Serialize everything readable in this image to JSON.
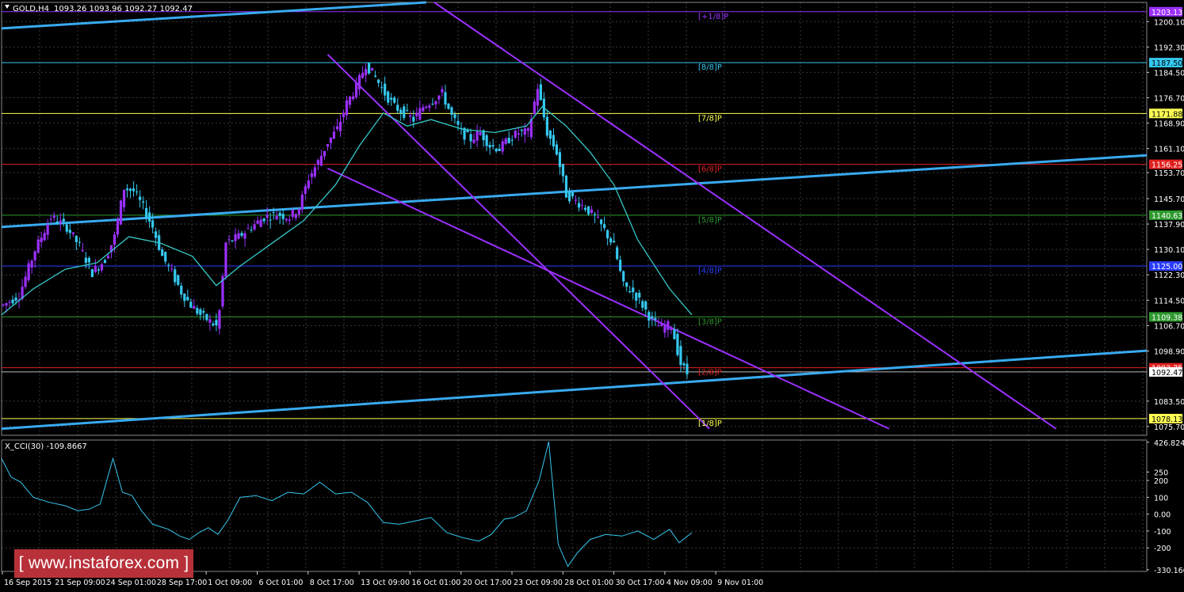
{
  "chart_header": {
    "symbol_label": "GOLD,H4",
    "ohlc": "1093.26 1093.96 1092.27 1092.47",
    "indicator_label": "X_CCI(30) -109.8667"
  },
  "watermark": {
    "text": "[ www.instaforex.com ]"
  },
  "colors": {
    "background": "#000000",
    "grid": "#3a3a3a",
    "bull": "#9b30ff",
    "bear": "#35c8f0",
    "ma": "#35c8c8",
    "channel_blue": "#39aaf0",
    "channel_purple": "#9b30ff",
    "cci": "#35c8f0"
  },
  "chart_data": {
    "type": "candlestick",
    "price_axis": {
      "ylim": [
        1073.0,
        1206.0
      ],
      "ticks": [
        "1200.10",
        "1192.30",
        "1184.50",
        "1176.70",
        "1168.90",
        "1161.10",
        "1153.70",
        "1145.70",
        "1137.90",
        "1130.10",
        "1122.30",
        "1114.50",
        "1106.70",
        "1098.90",
        "1083.50",
        "1075.70"
      ]
    },
    "time_axis": {
      "labels": [
        "16 Sep 2015",
        "21 Sep 09:00",
        "24 Sep 01:00",
        "28 Sep 17:00",
        "1 Oct 09:00",
        "6 Oct 01:00",
        "8 Oct 17:00",
        "13 Oct 09:00",
        "16 Oct 01:00",
        "20 Oct 17:00",
        "23 Oct 09:00",
        "28 Oct 01:00",
        "30 Oct 17:00",
        "4 Nov 09:00",
        "9 Nov 01:00"
      ]
    },
    "murrey_levels": [
      {
        "label": "[+1/8]P",
        "value": 1203.13,
        "price_text": "1203.13",
        "color": "#9b30ff"
      },
      {
        "label": "[8/8]P",
        "value": 1187.5,
        "price_text": "1187.50",
        "color": "#35c8f0"
      },
      {
        "label": "[7/8]P",
        "value": 1171.88,
        "price_text": "1171.88",
        "color": "#ffff55"
      },
      {
        "label": "[6/8]P",
        "value": 1156.25,
        "price_text": "1156.25",
        "color": "#e02020"
      },
      {
        "label": "[5/8]P",
        "value": 1140.63,
        "price_text": "1140.63",
        "color": "#2e9a2e"
      },
      {
        "label": "[4/8]P",
        "value": 1125.0,
        "price_text": "1125.00",
        "color": "#2a3cff"
      },
      {
        "label": "[3/8]P",
        "value": 1109.38,
        "price_text": "1109.38",
        "color": "#2e9a2e"
      },
      {
        "label": "[2/8]P",
        "value": 1093.75,
        "price_text": "1093.75",
        "color": "#e02020"
      },
      {
        "label": "[1/8]P",
        "value": 1078.13,
        "price_text": "1078.13",
        "color": "#ffff55"
      }
    ],
    "current_price": {
      "value": 1092.47,
      "price_text": "1092.47"
    },
    "close_path": [
      [
        0,
        1113
      ],
      [
        10,
        1116
      ],
      [
        20,
        1130
      ],
      [
        30,
        1140
      ],
      [
        40,
        1137
      ],
      [
        48,
        1131
      ],
      [
        56,
        1123
      ],
      [
        64,
        1127
      ],
      [
        70,
        1134
      ],
      [
        76,
        1149
      ],
      [
        82,
        1148
      ],
      [
        88,
        1143
      ],
      [
        94,
        1137
      ],
      [
        100,
        1128
      ],
      [
        106,
        1123
      ],
      [
        112,
        1117
      ],
      [
        118,
        1113
      ],
      [
        124,
        1110
      ],
      [
        130,
        1108
      ],
      [
        135,
        1106
      ],
      [
        140,
        1132
      ],
      [
        148,
        1134
      ],
      [
        156,
        1137
      ],
      [
        164,
        1140
      ],
      [
        172,
        1141
      ],
      [
        180,
        1140
      ],
      [
        186,
        1143
      ],
      [
        192,
        1152
      ],
      [
        198,
        1157
      ],
      [
        204,
        1163
      ],
      [
        210,
        1167
      ],
      [
        216,
        1175
      ],
      [
        222,
        1180
      ],
      [
        228,
        1187
      ],
      [
        234,
        1183
      ],
      [
        240,
        1178
      ],
      [
        246,
        1174
      ],
      [
        252,
        1172
      ],
      [
        258,
        1170
      ],
      [
        264,
        1174
      ],
      [
        270,
        1176
      ],
      [
        276,
        1178
      ],
      [
        282,
        1171
      ],
      [
        288,
        1166
      ],
      [
        294,
        1164
      ],
      [
        300,
        1166
      ],
      [
        306,
        1162
      ],
      [
        312,
        1161
      ],
      [
        318,
        1164
      ],
      [
        324,
        1166
      ],
      [
        330,
        1166
      ],
      [
        336,
        1180
      ],
      [
        342,
        1166
      ],
      [
        348,
        1160
      ],
      [
        354,
        1147
      ],
      [
        360,
        1145
      ],
      [
        366,
        1143
      ],
      [
        372,
        1140
      ],
      [
        378,
        1136
      ],
      [
        384,
        1131
      ],
      [
        390,
        1119
      ],
      [
        396,
        1117
      ],
      [
        402,
        1113
      ],
      [
        408,
        1108
      ],
      [
        414,
        1106
      ],
      [
        420,
        1107
      ],
      [
        426,
        1095
      ],
      [
        430,
        1092
      ]
    ],
    "ma_path": [
      [
        0,
        1110
      ],
      [
        20,
        1118
      ],
      [
        40,
        1124
      ],
      [
        60,
        1126
      ],
      [
        80,
        1134
      ],
      [
        100,
        1132
      ],
      [
        120,
        1128
      ],
      [
        135,
        1119
      ],
      [
        150,
        1125
      ],
      [
        170,
        1132
      ],
      [
        190,
        1139
      ],
      [
        210,
        1150
      ],
      [
        225,
        1162
      ],
      [
        240,
        1172
      ],
      [
        255,
        1168
      ],
      [
        270,
        1170
      ],
      [
        290,
        1167
      ],
      [
        310,
        1166
      ],
      [
        330,
        1168
      ],
      [
        340,
        1174
      ],
      [
        355,
        1168
      ],
      [
        370,
        1160
      ],
      [
        385,
        1150
      ],
      [
        400,
        1133
      ],
      [
        420,
        1118
      ],
      [
        434,
        1110
      ]
    ],
    "channels": [
      {
        "kind": "ascending",
        "color": "#39aaf0",
        "points": [
          [
            0,
            1137
          ],
          [
            720,
            1159
          ]
        ]
      },
      {
        "kind": "ascending",
        "color": "#39aaf0",
        "points": [
          [
            0,
            1075
          ],
          [
            720,
            1099
          ]
        ]
      },
      {
        "kind": "ascending",
        "color": "#39aaf0",
        "points": [
          [
            0,
            1198
          ],
          [
            267,
            1206
          ]
        ]
      },
      {
        "kind": "descending",
        "color": "#9b30ff",
        "points": [
          [
            272,
            1206
          ],
          [
            663,
            1075
          ]
        ]
      },
      {
        "kind": "descending",
        "color": "#9b30ff",
        "points": [
          [
            205,
            1190
          ],
          [
            445,
            1075
          ]
        ]
      },
      {
        "kind": "descending",
        "color": "#9b30ff",
        "points": [
          [
            205,
            1155
          ],
          [
            558,
            1075
          ]
        ]
      }
    ],
    "cci_axis": {
      "ylim": [
        -340,
        440
      ],
      "ticks": [
        "426.8245",
        "250",
        "200",
        "100",
        "0.00",
        "-100",
        "-200",
        "-330.1663"
      ]
    },
    "cci_path": [
      [
        0,
        330
      ],
      [
        6,
        220
      ],
      [
        12,
        190
      ],
      [
        20,
        100
      ],
      [
        30,
        70
      ],
      [
        40,
        50
      ],
      [
        48,
        20
      ],
      [
        55,
        30
      ],
      [
        62,
        60
      ],
      [
        70,
        330
      ],
      [
        76,
        130
      ],
      [
        82,
        110
      ],
      [
        88,
        20
      ],
      [
        95,
        -60
      ],
      [
        105,
        -90
      ],
      [
        112,
        -130
      ],
      [
        118,
        -150
      ],
      [
        124,
        -110
      ],
      [
        130,
        -80
      ],
      [
        136,
        -120
      ],
      [
        142,
        -40
      ],
      [
        150,
        100
      ],
      [
        160,
        110
      ],
      [
        170,
        80
      ],
      [
        180,
        130
      ],
      [
        190,
        120
      ],
      [
        200,
        190
      ],
      [
        210,
        120
      ],
      [
        220,
        130
      ],
      [
        230,
        70
      ],
      [
        240,
        -50
      ],
      [
        250,
        -60
      ],
      [
        260,
        -40
      ],
      [
        270,
        -20
      ],
      [
        280,
        -110
      ],
      [
        290,
        -140
      ],
      [
        300,
        -160
      ],
      [
        308,
        -120
      ],
      [
        316,
        -30
      ],
      [
        322,
        -20
      ],
      [
        330,
        20
      ],
      [
        338,
        200
      ],
      [
        344,
        430
      ],
      [
        350,
        -180
      ],
      [
        356,
        -310
      ],
      [
        362,
        -230
      ],
      [
        370,
        -150
      ],
      [
        380,
        -120
      ],
      [
        390,
        -130
      ],
      [
        400,
        -100
      ],
      [
        410,
        -150
      ],
      [
        420,
        -90
      ],
      [
        426,
        -170
      ],
      [
        434,
        -110
      ]
    ]
  }
}
